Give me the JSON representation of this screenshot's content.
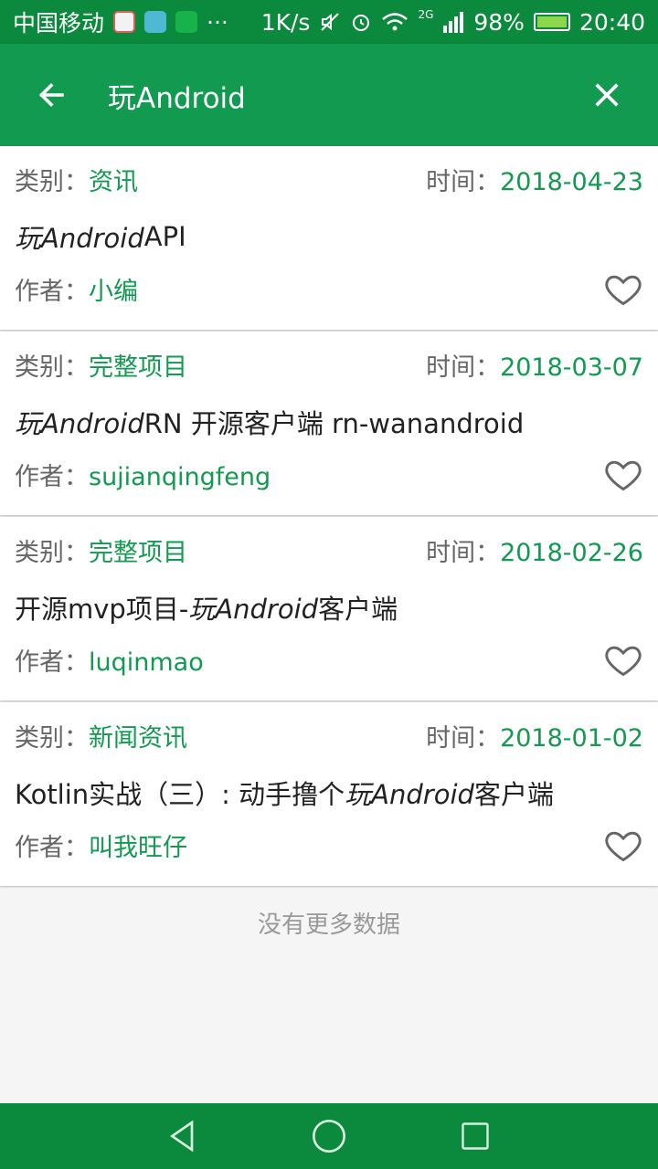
{
  "status_bar": {
    "carrier": "中国移动",
    "more": "···",
    "speed": "1K/s",
    "network": "2G",
    "battery": "98%",
    "time": "20:40"
  },
  "toolbar": {
    "title": "玩Android",
    "back_icon": "arrow-left-icon",
    "close_icon": "close-icon"
  },
  "labels": {
    "category": "类别：",
    "time": "时间：",
    "author": "作者："
  },
  "articles": [
    {
      "category": "资讯",
      "date": "2018-04-23",
      "title_pre": "",
      "title_em": "玩Android",
      "title_post": " API",
      "author": "小编"
    },
    {
      "category": "完整项目",
      "date": "2018-03-07",
      "title_pre": "",
      "title_em": "玩Android",
      "title_post": " RN 开源客户端 rn-wanandroid",
      "author": "sujianqingfeng"
    },
    {
      "category": "完整项目",
      "date": "2018-02-26",
      "title_pre": "开源mvp项目-",
      "title_em": "玩Android",
      "title_post": "客户端",
      "author": "luqinmao"
    },
    {
      "category": "新闻资讯",
      "date": "2018-01-02",
      "title_pre": "Kotlin实战（三）: 动手撸个",
      "title_em": "玩Android",
      "title_post": "客户端",
      "author": "叫我旺仔"
    }
  ],
  "footer": {
    "no_more": "没有更多数据"
  },
  "colors": {
    "primary": "#119a50",
    "status": "#0b8a3d",
    "text": "#222222",
    "label": "#666666"
  }
}
